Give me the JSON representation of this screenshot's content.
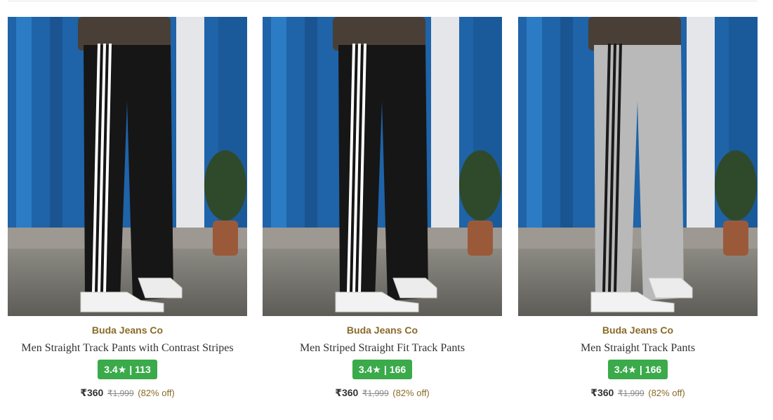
{
  "products": [
    {
      "brand": "Buda Jeans Co",
      "title": "Men Straight Track Pants with Contrast Stripes",
      "rating": "3.4★",
      "rating_separator": "|",
      "rating_count": "113",
      "price": "₹360",
      "mrp": "₹1,999",
      "discount": "(82% off)",
      "image_description": "black-track-pants-white-stripes",
      "pant_color": "#161616",
      "stripe_color": "#ffffff"
    },
    {
      "brand": "Buda Jeans Co",
      "title": "Men Striped Straight Fit Track Pants",
      "rating": "3.4★",
      "rating_separator": "|",
      "rating_count": "166",
      "price": "₹360",
      "mrp": "₹1,999",
      "discount": "(82% off)",
      "image_description": "black-track-pants-white-stripes",
      "pant_color": "#161616",
      "stripe_color": "#ffffff"
    },
    {
      "brand": "Buda Jeans Co",
      "title": "Men Straight Track Pants",
      "rating": "3.4★",
      "rating_separator": "|",
      "rating_count": "166",
      "price": "₹360",
      "mrp": "₹1,999",
      "discount": "(82% off)",
      "image_description": "grey-track-pants-black-stripes",
      "pant_color": "#b9b9b9",
      "stripe_color": "#1a1a1a"
    }
  ],
  "colors": {
    "brand_text": "#8a6a28",
    "rating_badge": "#3aaa4a",
    "background_wall": "#2a6fb5"
  }
}
